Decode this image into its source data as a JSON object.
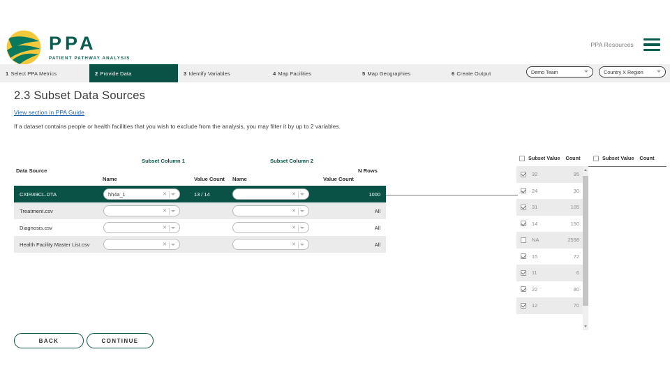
{
  "header": {
    "logo_title": "PPA",
    "logo_subtitle": "PATIENT PATHWAY ANALYSIS",
    "resources_label": "PPA Resources",
    "menu_icon": "hamburger-icon",
    "brand_green": "#0a5146",
    "brand_yellow": "#f2c94c"
  },
  "nav": {
    "items": [
      {
        "num": "1",
        "label": "Select PPA Metrics",
        "active": false
      },
      {
        "num": "2",
        "label": "Provide Data",
        "active": true
      },
      {
        "num": "3",
        "label": "Identify Variables",
        "active": false
      },
      {
        "num": "4",
        "label": "Map Facilities",
        "active": false
      },
      {
        "num": "5",
        "label": "Map Geographies",
        "active": false
      },
      {
        "num": "6",
        "label": "Create Output",
        "active": false
      }
    ],
    "team_select": "Demo Team",
    "region_select": "Country X Region"
  },
  "page": {
    "title": "2.3 Subset Data Sources",
    "guide_link": "View section in PPA Guide",
    "description": "If a dataset contains people or health facilities that you wish to exclude from the analysis, you may filter it by up to 2 variables."
  },
  "table": {
    "headers": {
      "data_source": "Data Source",
      "subset_col_1": "Subset Column 1",
      "subset_col_2": "Subset Column 2",
      "name_1": "Name",
      "value_count_1": "Value Count",
      "name_2": "Name",
      "value_count_2": "Value Count",
      "n_rows": "N Rows"
    },
    "rows": [
      {
        "source": "CXIR49CL.DTA",
        "col1_name": "hh4a_1",
        "col1_value_count": "13 / 14",
        "col2_name": "",
        "col2_value_count": "",
        "n_rows": "1000",
        "selected": true
      },
      {
        "source": "Treatment.csv",
        "col1_name": "",
        "col1_value_count": "",
        "col2_name": "",
        "col2_value_count": "",
        "n_rows": "All",
        "selected": false
      },
      {
        "source": "Diagnosis.csv",
        "col1_name": "",
        "col1_value_count": "",
        "col2_name": "",
        "col2_value_count": "",
        "n_rows": "All",
        "selected": false
      },
      {
        "source": "Health Facility Master List.csv",
        "col1_name": "",
        "col1_value_count": "",
        "col2_name": "",
        "col2_value_count": "",
        "n_rows": "All",
        "selected": false
      }
    ]
  },
  "value_panel": {
    "left_header_value": "Subset Value",
    "left_header_count": "Count",
    "right_header_value": "Subset Value",
    "right_header_count": "Count",
    "rows": [
      {
        "value": "32",
        "count": "95",
        "checked": true
      },
      {
        "value": "24",
        "count": "30",
        "checked": true
      },
      {
        "value": "31",
        "count": "105",
        "checked": true
      },
      {
        "value": "14",
        "count": "150",
        "checked": true
      },
      {
        "value": "NA",
        "count": "2598",
        "checked": false
      },
      {
        "value": "15",
        "count": "72",
        "checked": true
      },
      {
        "value": "11",
        "count": "6",
        "checked": true
      },
      {
        "value": "22",
        "count": "80",
        "checked": true
      },
      {
        "value": "12",
        "count": "70",
        "checked": true
      }
    ]
  },
  "footer": {
    "back_label": "BACK",
    "continue_label": "CONTINUE"
  }
}
